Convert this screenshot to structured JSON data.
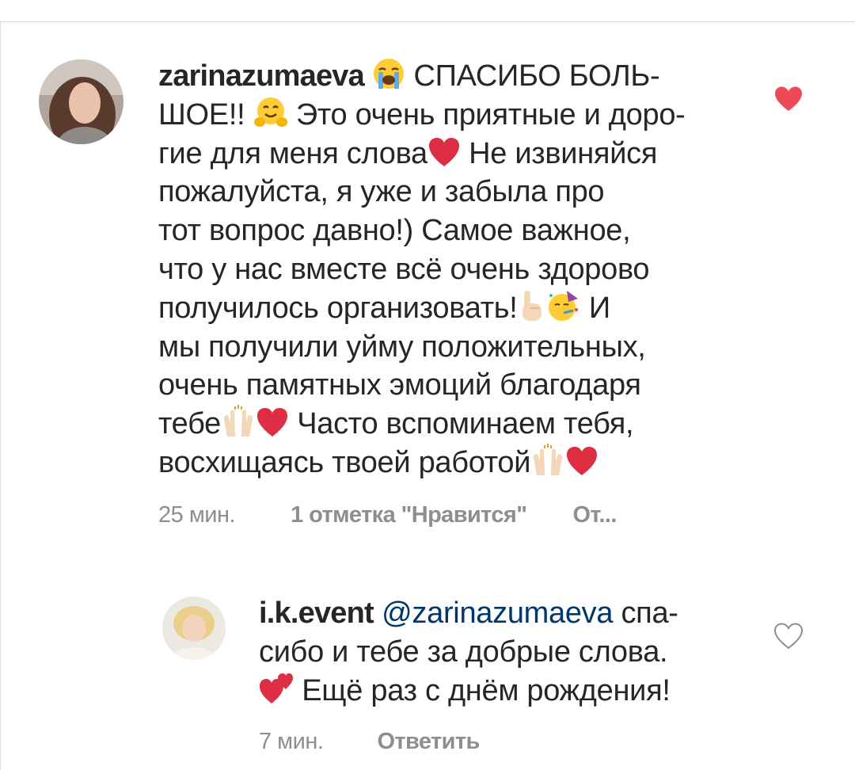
{
  "comments": [
    {
      "username": "zarinazumaeva",
      "lines": [
        {
          "pre": "",
          "after_emoji1": " СПАСИБО БОЛЬ-"
        },
        {
          "text1": "ШОЕ!! ",
          "text2": " Это очень приятные и доро-"
        },
        {
          "text1": "гие для меня слова",
          "text2": " Не извиняйся"
        },
        {
          "text": "пожалуйста, я уже и забыла про"
        },
        {
          "text": "тот вопрос давно!) Самое важное,"
        },
        {
          "text": "что у нас вместе всё очень здорово"
        },
        {
          "text1": "получилось организовать!",
          "text2": " И"
        },
        {
          "text": "мы получили уйму положительных,"
        },
        {
          "text": "очень памятных эмоций благодаря"
        },
        {
          "text1": "тебе",
          "text2": " Часто вспоминаем тебя,"
        },
        {
          "text1": "восхищаясь твоей работой"
        }
      ],
      "time": "25 мин.",
      "likes": "1 отметка \"Нравится\"",
      "reply": "От...",
      "liked": true,
      "emojis": [
        "loudly-crying-face",
        "hugging-face",
        "red-heart",
        "index-pointing-up",
        "partying-face",
        "raising-hands",
        "red-heart",
        "raising-hands",
        "red-heart"
      ]
    },
    {
      "username": "i.k.event",
      "mention": "@zarinazumaeva",
      "line1_rest": " спа-",
      "line2": "сибо и тебе за добрые слова.",
      "line3": " Ещё раз с днём рождения!",
      "time": "7 мин.",
      "reply": "Ответить",
      "liked": false,
      "emojis": [
        "two-hearts"
      ]
    }
  ],
  "colors": {
    "like_red": "#ed4956",
    "heart_red": "#dd2e44",
    "meta_gray": "#8e8e8e",
    "mention_blue": "#00376b"
  }
}
